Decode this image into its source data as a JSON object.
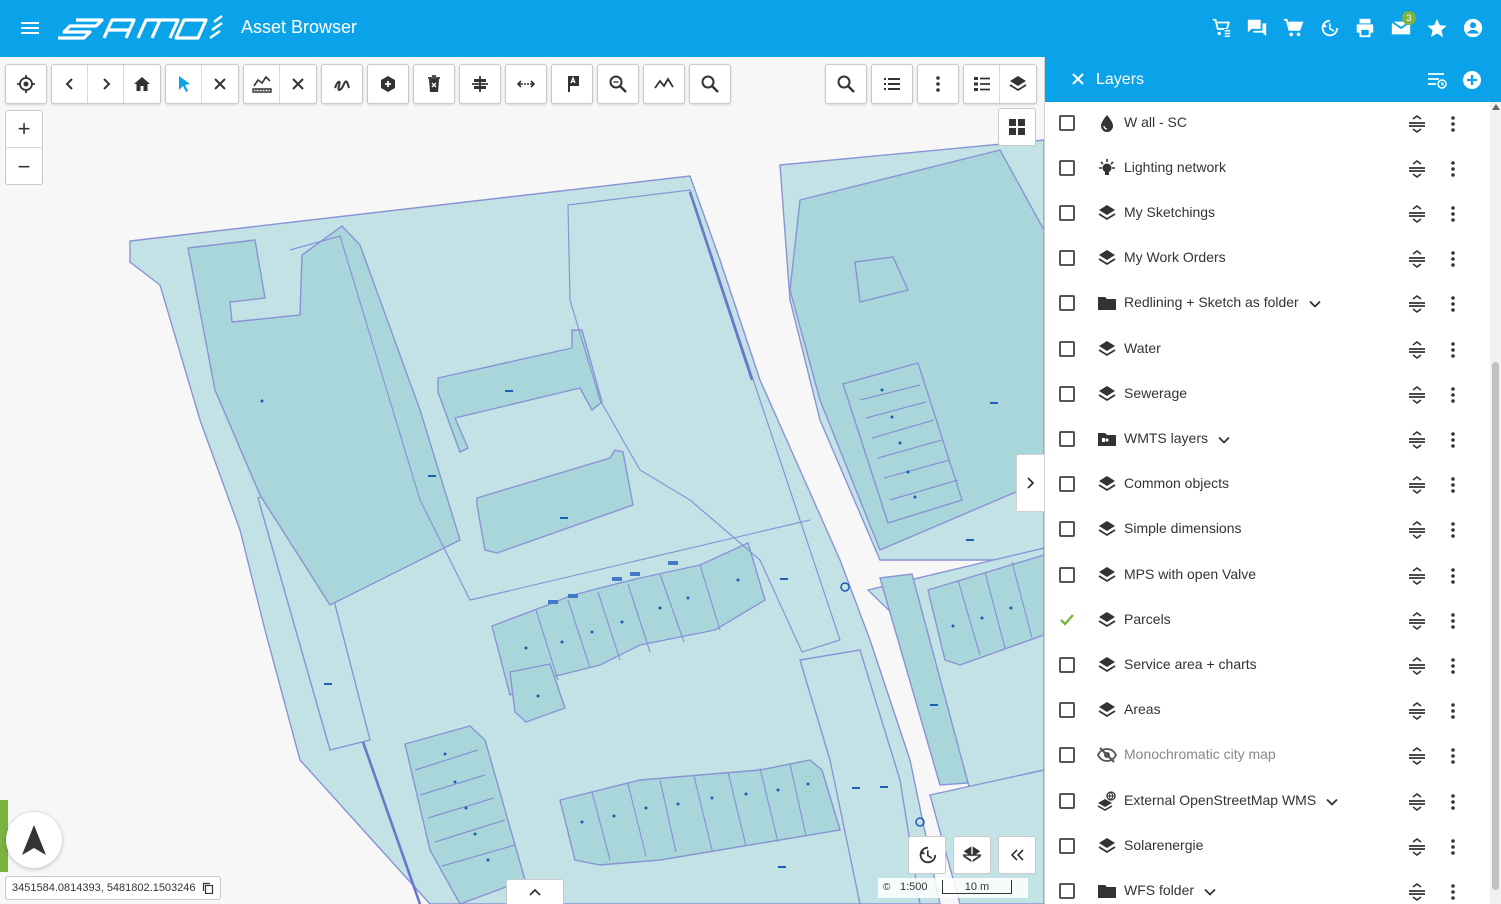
{
  "header": {
    "title": "Asset Browser",
    "logo_text": "samo",
    "mail_badge": "3",
    "icons": [
      "add-to-cart-icon",
      "chat-icon",
      "cart-icon",
      "history-icon",
      "print-icon",
      "mail-icon",
      "star-icon",
      "account-icon"
    ]
  },
  "map": {
    "coordinates": "3451584.0814393, 5481802.1503246",
    "scale_label": "1:500",
    "scale_bar": "10 m",
    "zoom_in": "+",
    "zoom_out": "−"
  },
  "panel": {
    "title": "Layers",
    "layers": [
      {
        "name": "W all - SC",
        "icon": "water-drop-icon",
        "checked": false,
        "expandable": false
      },
      {
        "name": "Lighting network",
        "icon": "lightbulb-icon",
        "checked": false,
        "expandable": false
      },
      {
        "name": "My Sketchings",
        "icon": "layers-icon",
        "checked": false,
        "expandable": false
      },
      {
        "name": "My Work Orders",
        "icon": "layers-icon",
        "checked": false,
        "expandable": false
      },
      {
        "name": "Redlining + Sketch as folder",
        "icon": "folder-icon",
        "checked": false,
        "expandable": true
      },
      {
        "name": "Water",
        "icon": "layers-icon",
        "checked": false,
        "expandable": false
      },
      {
        "name": "Sewerage",
        "icon": "layers-icon",
        "checked": false,
        "expandable": false
      },
      {
        "name": "WMTS layers",
        "icon": "folder-special-icon",
        "checked": false,
        "expandable": true
      },
      {
        "name": "Common objects",
        "icon": "layers-icon",
        "checked": false,
        "expandable": false
      },
      {
        "name": "Simple dimensions",
        "icon": "layers-icon",
        "checked": false,
        "expandable": false
      },
      {
        "name": "MPS with open Valve",
        "icon": "layers-icon",
        "checked": false,
        "expandable": false
      },
      {
        "name": "Parcels",
        "icon": "layers-icon",
        "checked": true,
        "expandable": false
      },
      {
        "name": "Service area + charts",
        "icon": "layers-icon",
        "checked": false,
        "expandable": false
      },
      {
        "name": "Areas",
        "icon": "layers-icon",
        "checked": false,
        "expandable": false
      },
      {
        "name": "Monochromatic city map",
        "icon": "visibility-off-icon",
        "checked": false,
        "expandable": false,
        "dim": true
      },
      {
        "name": "External OpenStreetMap WMS",
        "icon": "globe-layers-icon",
        "checked": false,
        "expandable": true
      },
      {
        "name": "Solarenergie",
        "icon": "layers-icon",
        "checked": false,
        "expandable": false
      },
      {
        "name": "WFS folder",
        "icon": "folder-icon",
        "checked": false,
        "expandable": true
      }
    ]
  },
  "colors": {
    "brand_blue": "#0aa2e8",
    "parcel_fill": "#c3e2e6",
    "parcel_fill_dark": "#a8d6da",
    "parcel_stroke": "#8a93d4",
    "check_green": "#7cb342"
  }
}
